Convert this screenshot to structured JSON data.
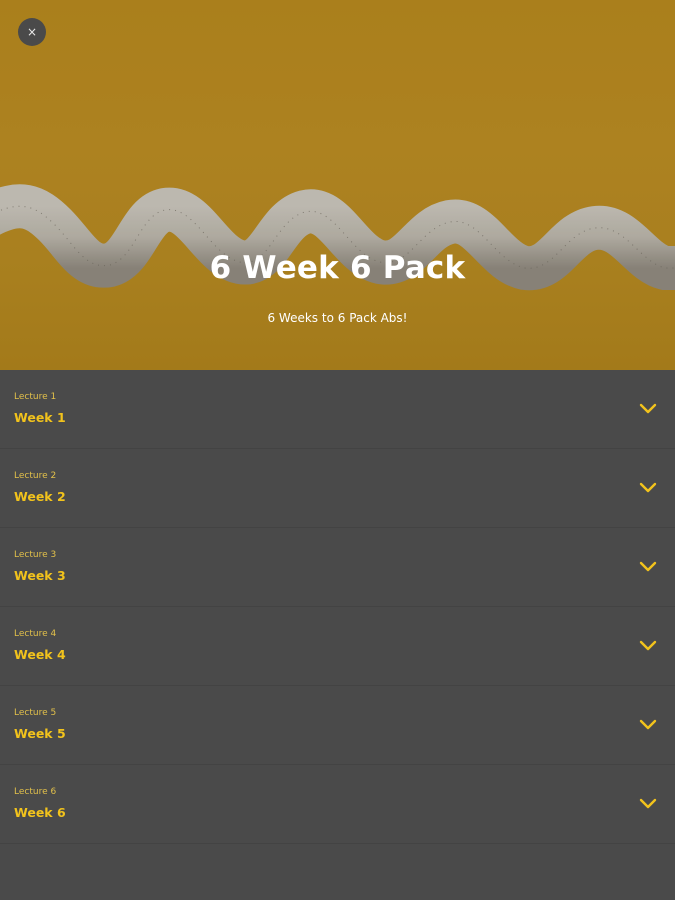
{
  "header": {
    "close_icon": "close-icon",
    "close_glyph": "×",
    "title": "6 Week 6 Pack",
    "subtitle": "6 Weeks to 6 Pack Abs!",
    "hero_image": "measuring-tape-on-yellow-background"
  },
  "colors": {
    "hero_background": "#b5871e",
    "list_background": "#4a4a4a",
    "accent": "#f2c31c",
    "title_text": "#ffffff"
  },
  "lectures": [
    {
      "label": "Lecture 1",
      "title": "Week 1",
      "icon": "chevron-down-icon"
    },
    {
      "label": "Lecture 2",
      "title": "Week 2",
      "icon": "chevron-down-icon"
    },
    {
      "label": "Lecture 3",
      "title": "Week 3",
      "icon": "chevron-down-icon"
    },
    {
      "label": "Lecture 4",
      "title": "Week 4",
      "icon": "chevron-down-icon"
    },
    {
      "label": "Lecture 5",
      "title": "Week 5",
      "icon": "chevron-down-icon"
    },
    {
      "label": "Lecture 6",
      "title": "Week 6",
      "icon": "chevron-down-icon"
    }
  ]
}
